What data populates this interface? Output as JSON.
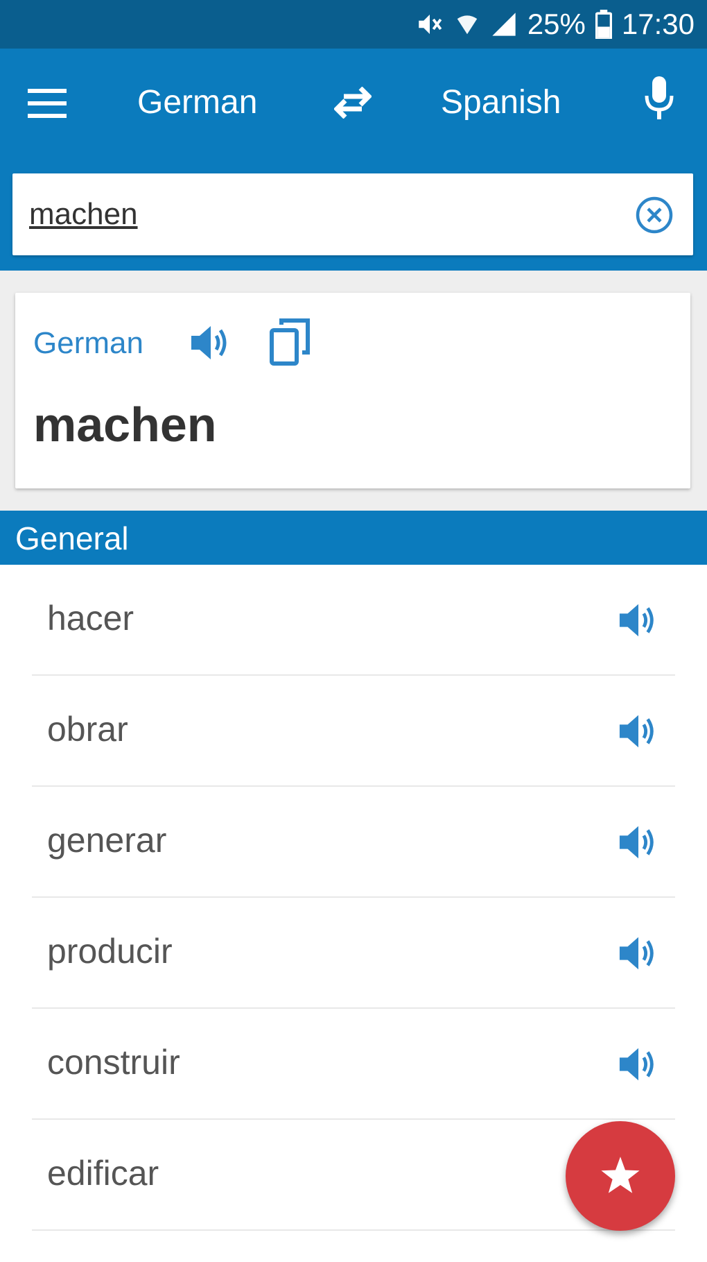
{
  "status_bar": {
    "battery": "25%",
    "time": "17:30",
    "icons": [
      "mute-icon",
      "wifi-icon",
      "signal-icon",
      "battery-icon"
    ]
  },
  "toolbar": {
    "source_language": "German",
    "target_language": "Spanish",
    "icons": [
      "menu-icon",
      "swap-icon",
      "microphone-icon"
    ]
  },
  "search": {
    "value": "machen",
    "icon": "clear-icon"
  },
  "card": {
    "language": "German",
    "word": "machen",
    "icons": [
      "speaker-icon",
      "copy-icon"
    ]
  },
  "section": {
    "title": "General"
  },
  "translations": [
    {
      "word": "hacer",
      "icon": "speaker-icon"
    },
    {
      "word": "obrar",
      "icon": "speaker-icon"
    },
    {
      "word": "generar",
      "icon": "speaker-icon"
    },
    {
      "word": "producir",
      "icon": "speaker-icon"
    },
    {
      "word": "construir",
      "icon": "speaker-icon"
    },
    {
      "word": "edificar",
      "icon": "speaker-icon"
    }
  ],
  "fab": {
    "icon": "star-icon"
  },
  "colors": {
    "status_bar": "#0a5e8e",
    "primary": "#0b7bbd",
    "accent_text": "#2d86c9",
    "fab": "#d63b40",
    "background": "#eeeeee"
  }
}
